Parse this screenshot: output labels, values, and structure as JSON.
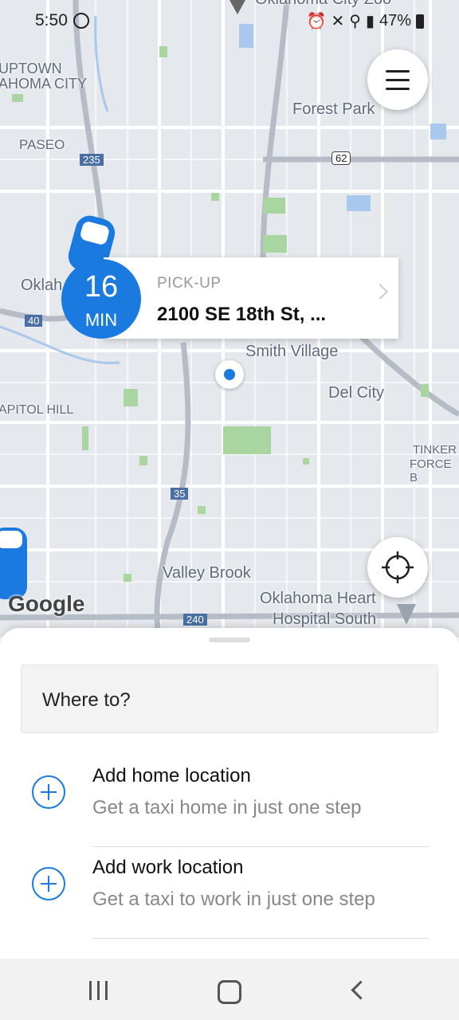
{
  "status_bar": {
    "time": "5:50",
    "battery": "47%"
  },
  "map": {
    "labels": {
      "uptown": "UPTOWN",
      "okc": "AHOMA CITY",
      "forest_park": "Forest Park",
      "paseo": "PASEO",
      "okla": "Oklah",
      "smith_village": "Smith Village",
      "del_city": "Del City",
      "capitol_hill": "APITOL HILL",
      "tinker1": "TINKER",
      "tinker2": "FORCE B",
      "valley_brook": "Valley Brook",
      "heart1": "Oklahoma Heart",
      "heart2": "Hospital South",
      "zoo": "Oklahoma City Zoo",
      "i235": "235",
      "us62": "62",
      "i40": "40",
      "i35": "35",
      "i240": "240"
    },
    "attribution": "Google"
  },
  "pickup": {
    "label": "PICK-UP",
    "address": "2100 SE 18th St, ...",
    "eta_value": "16",
    "eta_unit": "MIN"
  },
  "sheet": {
    "search_placeholder": "Where to?",
    "items": [
      {
        "title": "Add home location",
        "subtitle": "Get a taxi home in just one step"
      },
      {
        "title": "Add work location",
        "subtitle": "Get a taxi to work in just one step"
      }
    ]
  },
  "colors": {
    "accent": "#1a7ae0",
    "map_bg": "#e5e8ec"
  }
}
